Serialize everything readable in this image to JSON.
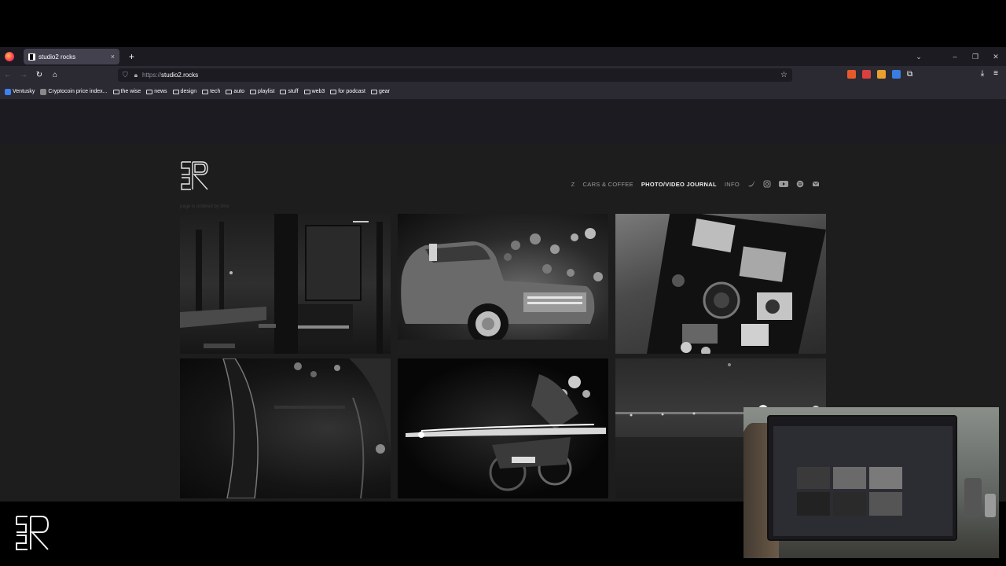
{
  "browser": {
    "tab_title": "studio2 rocks",
    "tab_close": "×",
    "new_tab": "+",
    "url_protocol": "https://",
    "url_host": "studio2.rocks",
    "bookmarks": [
      {
        "label": "Ventusky",
        "type": "site"
      },
      {
        "label": "Cryptocoin price index...",
        "type": "site"
      },
      {
        "label": "the wise",
        "type": "folder"
      },
      {
        "label": "news",
        "type": "folder"
      },
      {
        "label": "design",
        "type": "folder"
      },
      {
        "label": "tech",
        "type": "folder"
      },
      {
        "label": "auto",
        "type": "folder"
      },
      {
        "label": "playlist",
        "type": "folder"
      },
      {
        "label": "stuff",
        "type": "folder"
      },
      {
        "label": "web3",
        "type": "folder"
      },
      {
        "label": "for podcast",
        "type": "folder"
      },
      {
        "label": "gear",
        "type": "folder"
      }
    ]
  },
  "site": {
    "nav": {
      "z": "Z",
      "cars": "CARS & COFFEE",
      "journal": "PHOTO/VIDEO JOURNAL",
      "info": "INFO"
    },
    "social_icons": [
      "twitter-icon",
      "instagram-icon",
      "youtube-icon",
      "spotify-icon",
      "mail-icon"
    ],
    "subtitle": "page is ordered by time",
    "tiles": [
      "bar-interior",
      "vintage-pickup-truck",
      "cameras-in-box",
      "glass-closeup",
      "motorcycle-light-trails",
      "foggy-road-lights"
    ]
  },
  "colors": {
    "accent": "#f0f0f0",
    "page_bg": "#1d1d1d",
    "browser_bg": "#1c1b22"
  }
}
